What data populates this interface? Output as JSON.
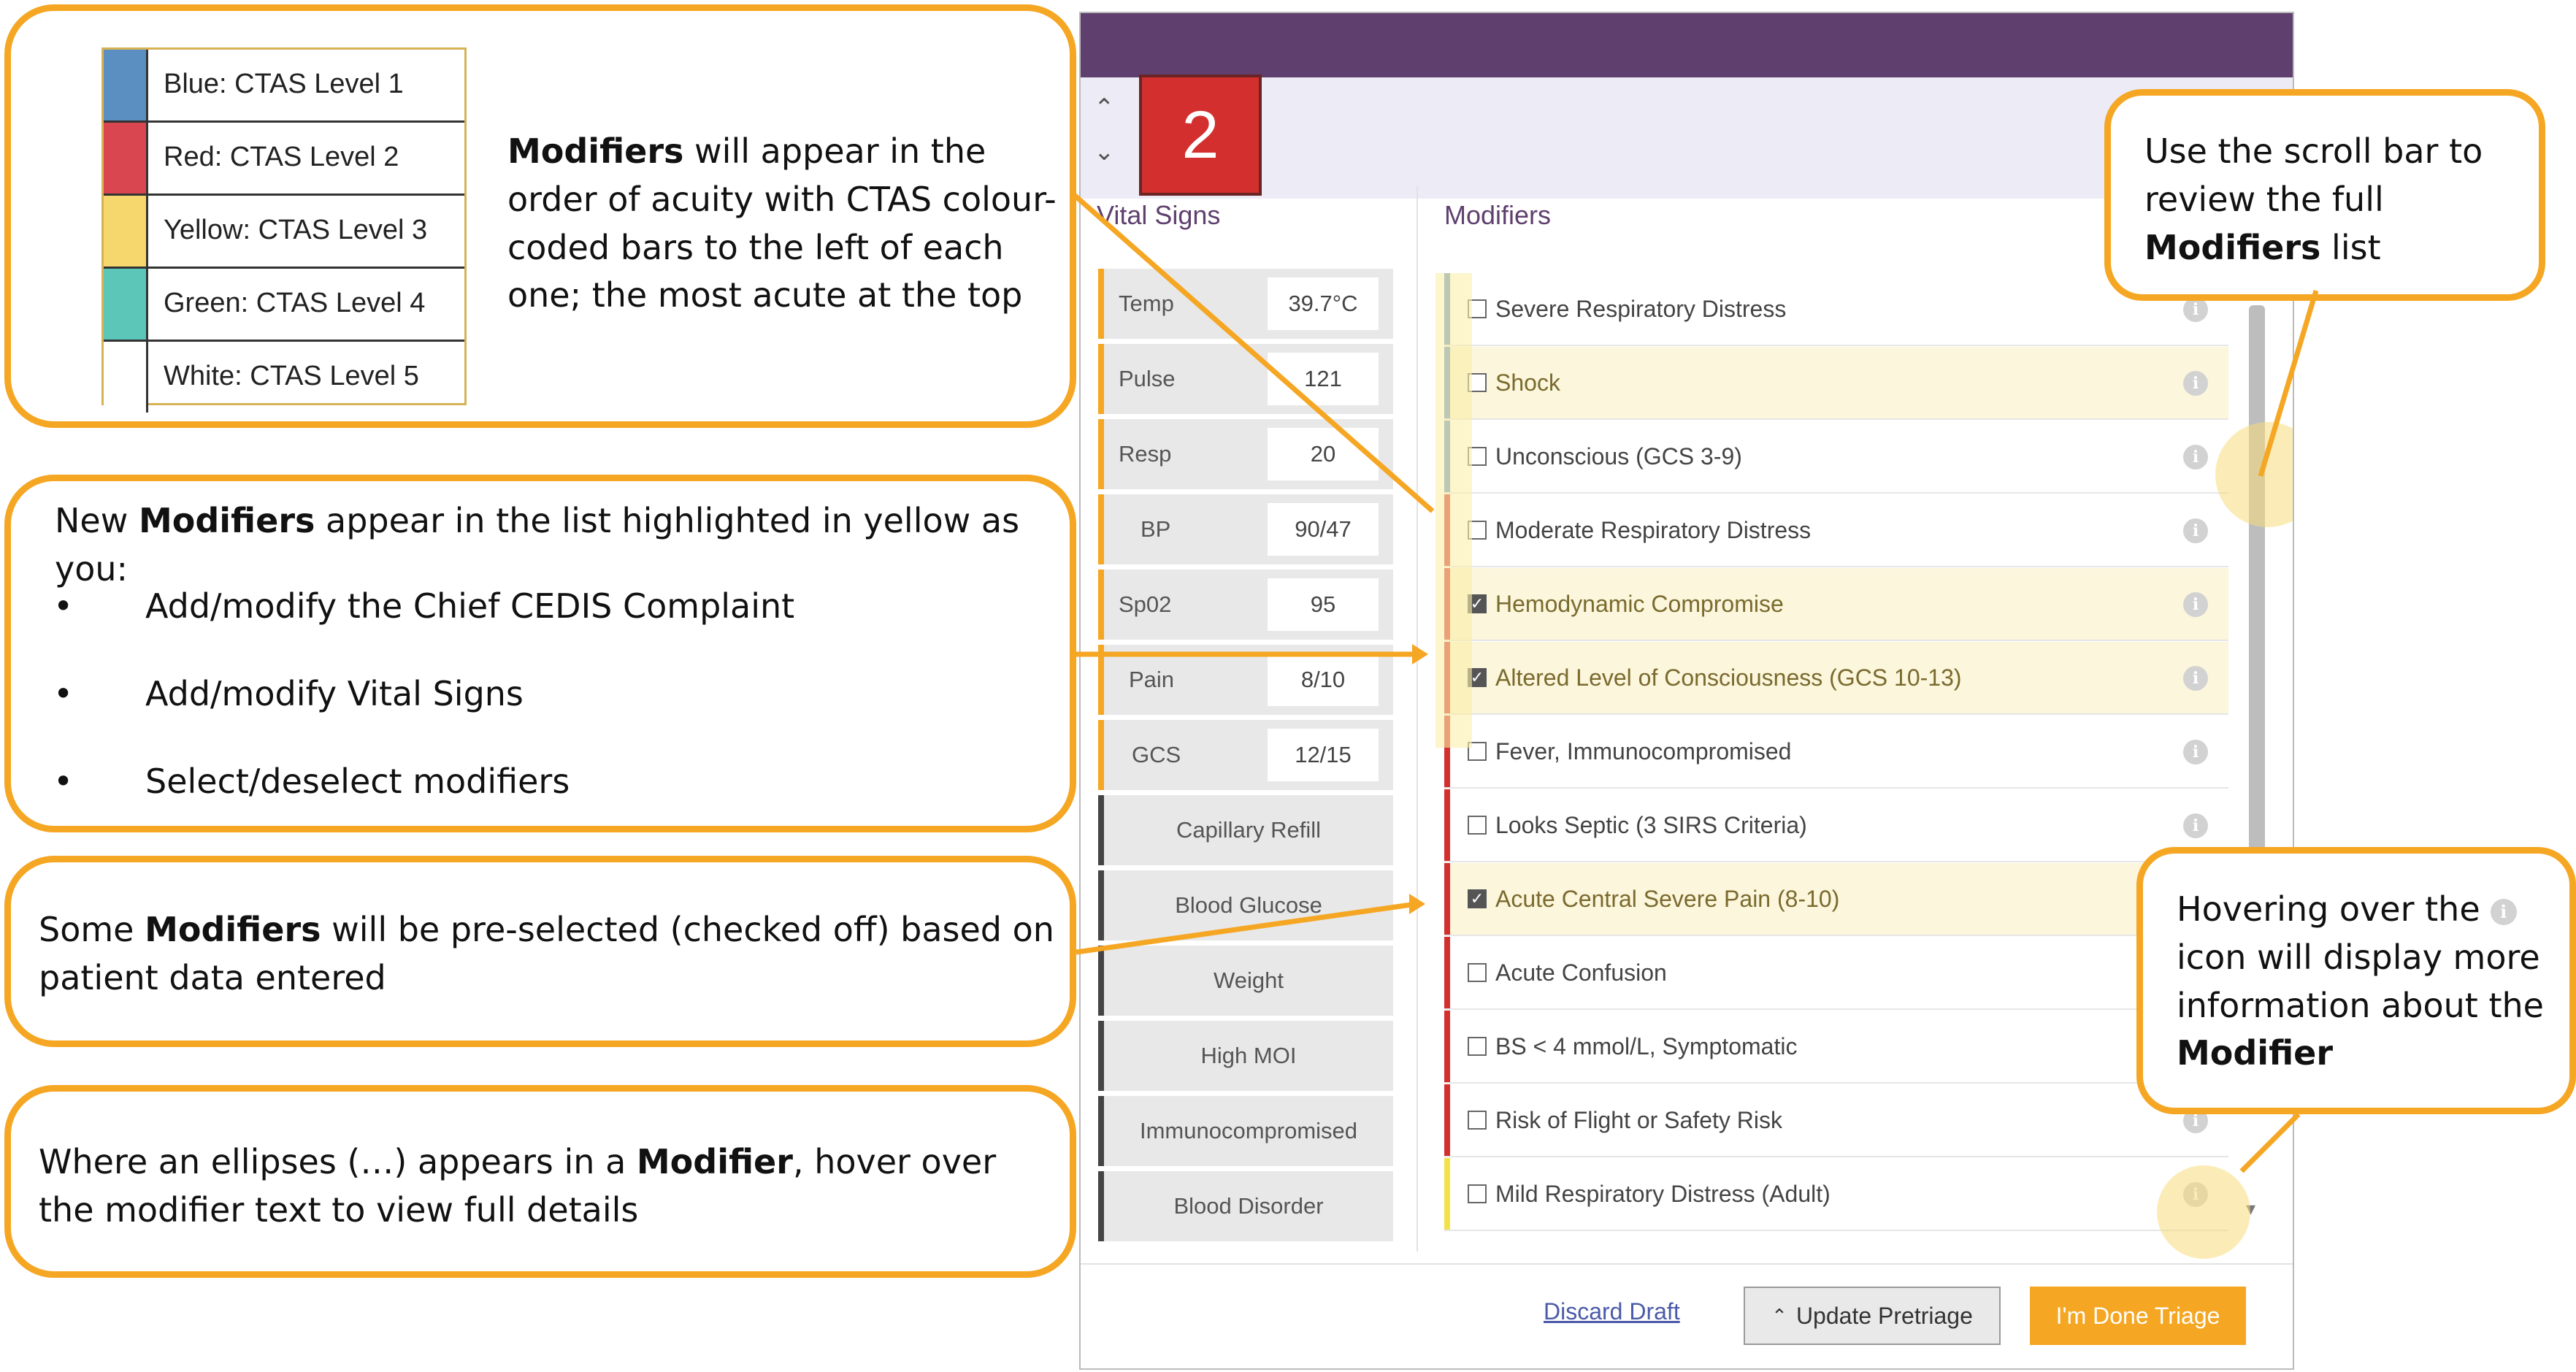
{
  "app": {
    "ctas_level": "2",
    "vital_signs_title": "Vital Signs",
    "modifiers_title": "Modifiers",
    "nav": {
      "up_icon": "chevron-up-icon",
      "down_icon": "chevron-down-icon"
    }
  },
  "vital_signs": [
    {
      "label": "Temp",
      "value": "39.7°C"
    },
    {
      "label": "Pulse",
      "value": "121"
    },
    {
      "label": "Resp",
      "value": "20"
    },
    {
      "label": "BP",
      "value": "90/47"
    },
    {
      "label": "Sp02",
      "value": "95"
    },
    {
      "label": "Pain",
      "value": "8/10"
    },
    {
      "label": "GCS",
      "value": "12/15"
    }
  ],
  "vital_buttons": [
    "Capillary Refill",
    "Blood Glucose",
    "Weight",
    "High MOI",
    "Immunocompromised",
    "Blood Disorder"
  ],
  "modifiers": [
    {
      "label": "Severe Respiratory Distress",
      "checked": false,
      "highlighted": false,
      "ctas_color": "#5b8fc2"
    },
    {
      "label": "Shock",
      "checked": false,
      "highlighted": true,
      "ctas_color": "#5b8fc2"
    },
    {
      "label": "Unconscious (GCS 3-9)",
      "checked": false,
      "highlighted": false,
      "ctas_color": "#5b8fc2"
    },
    {
      "label": "Moderate Respiratory Distress",
      "checked": false,
      "highlighted": false,
      "ctas_color": "#d32f2f"
    },
    {
      "label": "Hemodynamic Compromise",
      "checked": true,
      "highlighted": true,
      "ctas_color": "#d32f2f"
    },
    {
      "label": "Altered Level of Consciousness (GCS 10-13)",
      "checked": true,
      "highlighted": true,
      "ctas_color": "#d32f2f"
    },
    {
      "label": "Fever, Immunocompromised",
      "checked": false,
      "highlighted": false,
      "ctas_color": "#d32f2f"
    },
    {
      "label": "Looks Septic (3 SIRS Criteria)",
      "checked": false,
      "highlighted": false,
      "ctas_color": "#d32f2f"
    },
    {
      "label": "Acute Central Severe Pain (8-10)",
      "checked": true,
      "highlighted": true,
      "ctas_color": "#d32f2f"
    },
    {
      "label": "Acute Confusion",
      "checked": false,
      "highlighted": false,
      "ctas_color": "#d32f2f"
    },
    {
      "label": "BS < 4 mmol/L, Symptomatic",
      "checked": false,
      "highlighted": false,
      "ctas_color": "#d32f2f"
    },
    {
      "label": "Risk of Flight or Safety Risk",
      "checked": false,
      "highlighted": false,
      "ctas_color": "#d32f2f"
    },
    {
      "label": "Mild Respiratory Distress (Adult)",
      "checked": false,
      "highlighted": false,
      "ctas_color": "#f2e24a"
    }
  ],
  "footer": {
    "discard": "Discard Draft",
    "update": "Update Pretriage",
    "done": "I'm Done Triage"
  },
  "legend": [
    {
      "label": "Blue: CTAS Level 1",
      "color": "#5b8fc2"
    },
    {
      "label": "Red: CTAS Level 2",
      "color": "#d9464f"
    },
    {
      "label": "Yellow: CTAS Level 3",
      "color": "#f5d76e"
    },
    {
      "label": "Green: CTAS Level 4",
      "color": "#5cc6b8"
    },
    {
      "label": "White: CTAS Level 5",
      "color": "#ffffff"
    }
  ],
  "callouts": {
    "c1": {
      "bold": "Modifiers",
      "rest": " will appear in the order of acuity with CTAS colour-coded bars to the left of each one; the most acute at the top"
    },
    "c2": {
      "pre": "New ",
      "bold": "Modifiers",
      "post": " appear in the list highlighted in yellow as you:",
      "bullets": [
        "Add/modify the Chief CEDIS Complaint",
        "Add/modify Vital Signs",
        "Select/deselect modifiers"
      ]
    },
    "c3": {
      "pre": "Some ",
      "bold": "Modifiers",
      "post": " will be pre-selected (checked off) based on patient data entered"
    },
    "c4": {
      "pre": "Where an ellipses (…) appears in a ",
      "bold": "Modifier",
      "post": ", hover over the modifier text to view full details"
    },
    "c5": {
      "pre": "Use the scroll bar to review the full ",
      "bold": "Modifiers",
      "post": " list"
    },
    "c6": {
      "pre": "Hovering over the",
      "post": " icon will display more information about the ",
      "bold": "Modifier"
    }
  }
}
